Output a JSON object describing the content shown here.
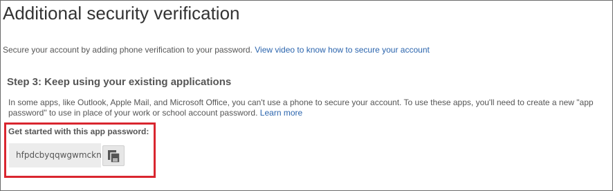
{
  "page": {
    "title": "Additional security verification"
  },
  "intro": {
    "text": "Secure your account by adding phone verification to your password.",
    "link_label": "View video to know how to secure your account"
  },
  "step": {
    "heading": "Step 3: Keep using your existing applications",
    "description": "In some apps, like Outlook, Apple Mail, and Microsoft Office, you can't use a phone to secure your account. To use these apps, you'll need to create a new \"app password\" to use in place of your work or school account password.",
    "learn_more_label": "Learn more"
  },
  "app_password": {
    "label": "Get started with this app password:",
    "value": "hfpdcbyqqwgwmckn",
    "copy_icon": "copy-icon"
  },
  "colors": {
    "link": "#2a64ad",
    "highlight": "#d9262f",
    "text": "#555555"
  }
}
